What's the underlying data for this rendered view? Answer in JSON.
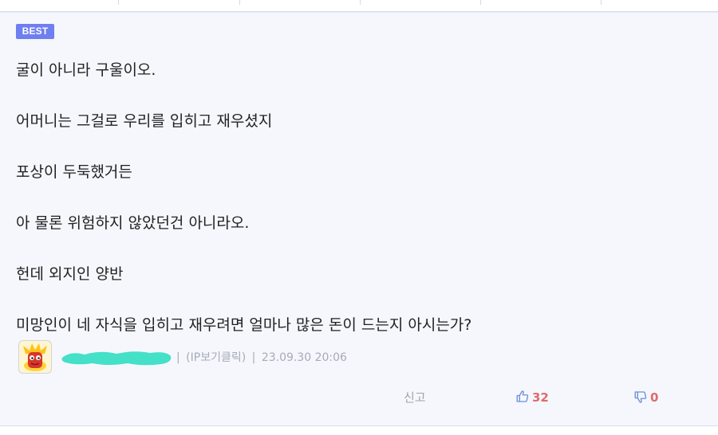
{
  "comment": {
    "badge": "BEST",
    "lines": [
      "굴이 아니라 구울이오.",
      "어머니는 그걸로 우리를 입히고 재우셨지",
      "포상이 두둑했거든",
      "아 물론 위험하지 않았던건 아니라오.",
      "헌데 외지인 양반",
      "미망인이 네 자식을 입히고 재우려면 얼마나 많은 돈이 드는지 아시는가?"
    ],
    "author": {
      "avatar_icon": "character-avatar-icon",
      "nickname_censored": true,
      "ip_label": "(IP보기클릭)",
      "date": "23.09.30 20:06",
      "separator": "|"
    },
    "actions": {
      "report_label": "신고",
      "like_icon": "thumbs-up-icon",
      "like_count": "32",
      "dislike_icon": "thumbs-down-icon",
      "dislike_count": "0"
    }
  },
  "colors": {
    "badge": "#6f7ef0",
    "card_bg": "#f5f7fd",
    "vote_count": "#e06b6b",
    "like_icon": "#6c8fd6",
    "meta_text": "#a7abb5",
    "censor": "#45e0c8"
  }
}
